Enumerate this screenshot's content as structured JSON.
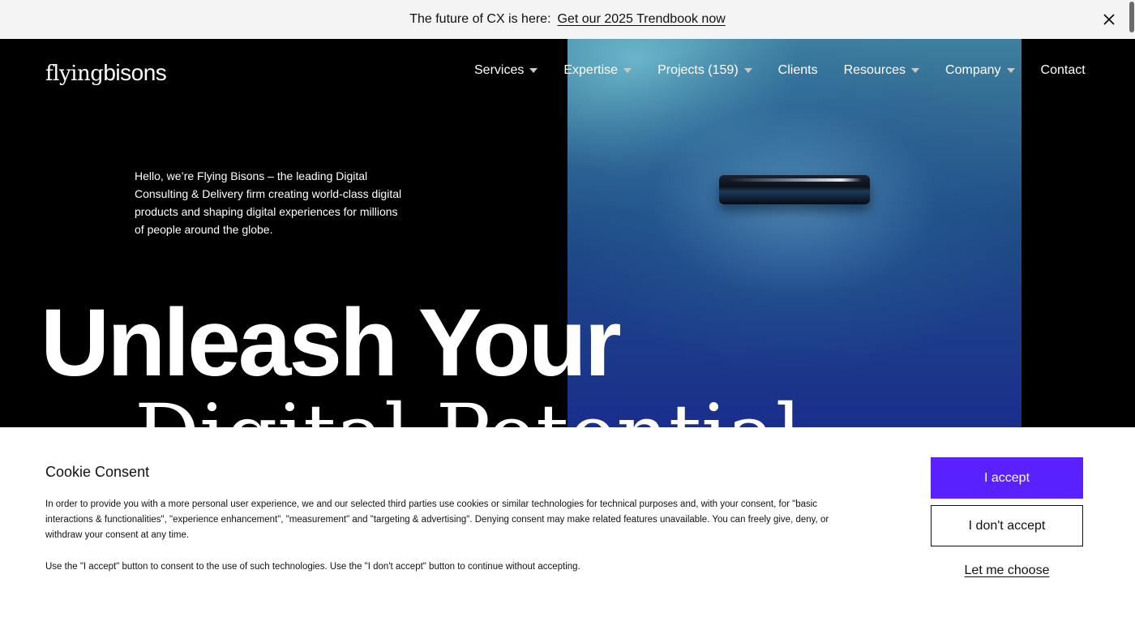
{
  "announcement": {
    "lead": "The future of CX is here:",
    "link": "Get our 2025 Trendbook now",
    "close_icon": "close-icon"
  },
  "header": {
    "logo_part1": "flying",
    "logo_part2": "bisons",
    "nav": [
      {
        "label": "Services",
        "has_dropdown": true
      },
      {
        "label": "Expertise",
        "has_dropdown": true
      },
      {
        "label": "Projects (159)",
        "has_dropdown": true
      },
      {
        "label": "Clients",
        "has_dropdown": false
      },
      {
        "label": "Resources",
        "has_dropdown": true
      },
      {
        "label": "Company",
        "has_dropdown": true
      },
      {
        "label": "Contact",
        "has_dropdown": false
      }
    ]
  },
  "hero": {
    "intro": "Hello, we’re Flying Bisons – the leading Digital Consulting & Delivery firm creating world-class digital products and shaping digital experiences for millions of people around the globe.",
    "headline_line1": "Unleash Your",
    "headline_line2": "Digital Potential"
  },
  "cookie": {
    "title": "Cookie Consent",
    "body": "In order to provide you with a more personal user experience, we and our selected third parties use cookies or similar technologies for technical purposes and, with your consent, for \"basic interactions & functionalities\", \"experience enhancement\", \"measurement\" and \"targeting & advertising\". Denying consent may make related features unavailable. You can freely give, deny, or withdraw your consent at any time.",
    "note": "Use the \"I accept\" button to consent to the use of such technologies. Use the \"I don't accept\" button to continue without accepting.",
    "accept_label": "I accept",
    "decline_label": "I don't accept",
    "choose_label": "Let me choose"
  },
  "colors": {
    "accent": "#5a21ff",
    "announcement_bg": "#f4f4f4",
    "hero_bg": "#000000"
  }
}
